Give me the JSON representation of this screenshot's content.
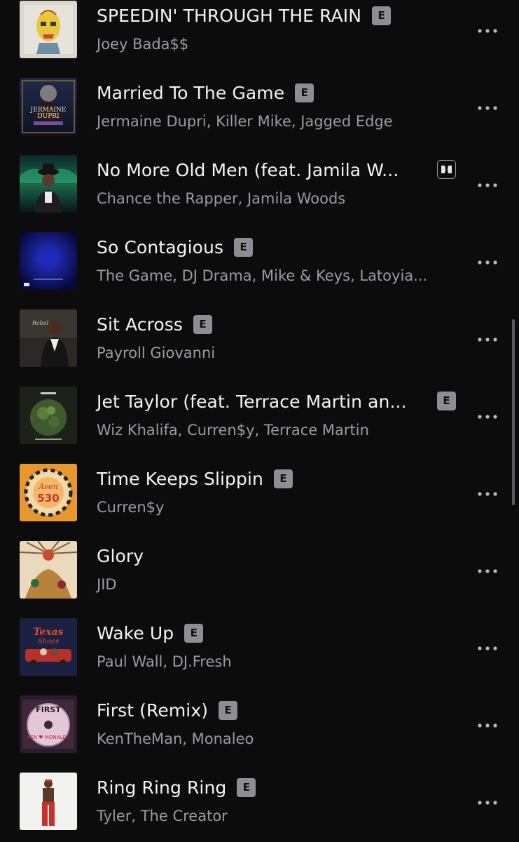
{
  "tracks": [
    {
      "title": "SPEEDIN' THROUGH THE RAIN",
      "artist": "Joey Bada$$",
      "badge": "E"
    },
    {
      "title": "Married To The Game",
      "artist": "Jermaine Dupri, Killer Mike, Jagged Edge",
      "badge": "E"
    },
    {
      "title": "No More Old Men (feat. Jamila W...",
      "artist": "Chance the Rapper, Jamila Woods",
      "badge": "dolby"
    },
    {
      "title": "So Contagious",
      "artist": "The Game, DJ Drama, Mike & Keys, Latoyia...",
      "badge": "E"
    },
    {
      "title": "Sit Across",
      "artist": "Payroll Giovanni",
      "badge": "E"
    },
    {
      "title": "Jet Taylor (feat. Terrace Martin an...",
      "artist": "Wiz Khalifa, Curren$y, Terrace Martin",
      "badge": "E"
    },
    {
      "title": "Time Keeps Slippin",
      "artist": "Curren$y",
      "badge": "E"
    },
    {
      "title": "Glory",
      "artist": "JID",
      "badge": ""
    },
    {
      "title": "Wake Up",
      "artist": "Paul Wall, DJ.Fresh",
      "badge": "E"
    },
    {
      "title": "First (Remix)",
      "artist": "KenTheMan, Monaleo",
      "badge": "E"
    },
    {
      "title": "Ring Ring Ring",
      "artist": "Tyler, The Creator",
      "badge": "E"
    }
  ],
  "explicit_label": "E",
  "icons": {
    "more": "more-horizontal-icon",
    "dolby": "dolby-atmos-icon",
    "explicit": "explicit-badge"
  },
  "colors": {
    "background": "#0c0c0d",
    "title": "#f4f4f5",
    "subtitle": "#9b9ba2",
    "badge": "#8d8d93"
  }
}
